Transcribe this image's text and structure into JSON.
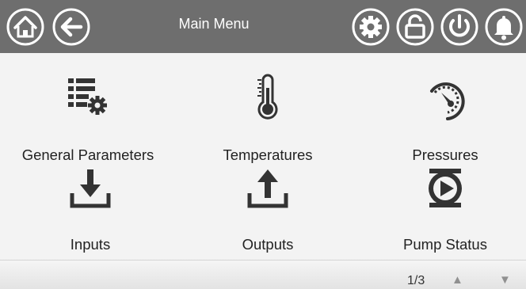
{
  "header": {
    "title": "Main Menu",
    "left_icons": [
      "home-icon",
      "back-arrow-icon"
    ],
    "right_icons": [
      "settings-gear-icon",
      "unlock-icon",
      "power-icon",
      "alarm-bell-icon"
    ]
  },
  "menu": {
    "items": [
      {
        "label": "General Parameters",
        "icon": "general-parameters-icon"
      },
      {
        "label": "Temperatures",
        "icon": "thermometer-icon"
      },
      {
        "label": "Pressures",
        "icon": "pressure-gauge-icon"
      },
      {
        "label": "Inputs",
        "icon": "download-inputs-icon"
      },
      {
        "label": "Outputs",
        "icon": "upload-outputs-icon"
      },
      {
        "label": "Pump Status",
        "icon": "pump-icon"
      }
    ]
  },
  "footer": {
    "page_indicator": "1/3",
    "up_arrow": "▲",
    "down_arrow": "▼"
  },
  "colors": {
    "header_bg": "#6e6e6e",
    "icon_fill": "#333333",
    "header_icon": "#ffffff"
  }
}
